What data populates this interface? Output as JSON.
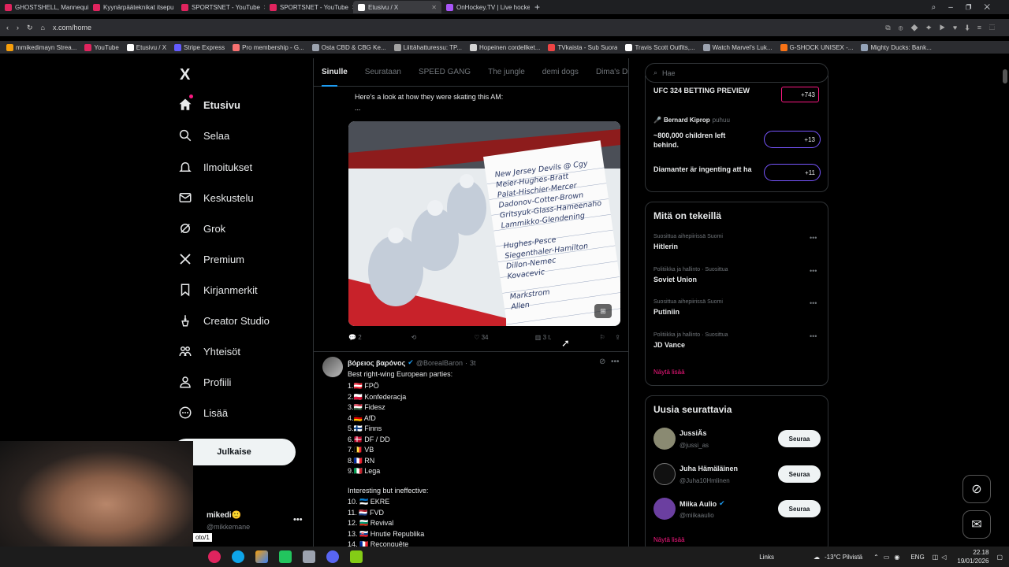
{
  "browser": {
    "tabs": [
      {
        "title": "GHOSTSHELL, Mannequin",
        "color": "#e0245e"
      },
      {
        "title": "Kyynärpääteknikat itsepu",
        "color": "#e0245e"
      },
      {
        "title": "SPORTSNET - YouTube",
        "color": "#e0245e"
      },
      {
        "title": "SPORTSNET - YouTube",
        "color": "#e0245e"
      },
      {
        "title": "Etusivu / X",
        "color": "#ffffff"
      },
      {
        "title": "OnHockey.TV | Live hocke",
        "color": "#a855f7"
      }
    ],
    "url": "x.com/home",
    "bookmarks": [
      "mmikedimayn Strea...",
      "YouTube",
      "Etusivu / X",
      "Stripe Express",
      "Pro membership - G...",
      "Osta CBD & CBG Ke...",
      "Liittähatturessu: TP...",
      "Hopeinen cordellket...",
      "TVkaista - Sub Suora",
      "Travis Scott Outfits,...",
      "Watch Marvel's Luk...",
      "G-SHOCK UNISEX -...",
      "Mighty Ducks: Bank..."
    ]
  },
  "nav": {
    "logo": "X",
    "items": [
      {
        "label": "Etusivu",
        "icon": "home-icon"
      },
      {
        "label": "Selaa",
        "icon": "search-icon"
      },
      {
        "label": "Ilmoitukset",
        "icon": "bell-icon"
      },
      {
        "label": "Keskustelu",
        "icon": "mail-icon"
      },
      {
        "label": "Grok",
        "icon": "grok-icon"
      },
      {
        "label": "Premium",
        "icon": "x-icon"
      },
      {
        "label": "Kirjanmerkit",
        "icon": "bookmark-icon"
      },
      {
        "label": "Creator Studio",
        "icon": "creator-icon"
      },
      {
        "label": "Yhteisöt",
        "icon": "communities-icon"
      },
      {
        "label": "Profiili",
        "icon": "person-icon"
      },
      {
        "label": "Lisää",
        "icon": "more-icon"
      }
    ],
    "post_button": "Julkaise",
    "account": {
      "name": "mikedi🙂",
      "handle": "@mikkemane"
    },
    "tooltip": "oto/1"
  },
  "feed": {
    "tabs": [
      "Sinulle",
      "Seurataan",
      "SPEED GANG",
      "The jungle",
      "demi dogs",
      "Dima's Dist"
    ],
    "post1": {
      "text": "Here's a look at how they were skating this AM:",
      "ellipsis": "...",
      "notepad_lines": [
        "New Jersey Devils @ Cgy",
        "Meier-Hughes-Bratt",
        "Palat-Hischier-Mercer",
        "Dadonov-Cotter-Brown",
        "Gritsyuk-Glass-Hameenaho",
        "Lammikko-Glendening",
        "",
        "Hughes-Pesce",
        "Siegenthaler-Hamilton",
        "Dillon-Nemec",
        "Kovacevic",
        "",
        "Markstrom",
        "Allen"
      ],
      "stats": {
        "replies": "2",
        "reposts": "",
        "likes": "34",
        "views": "3 t."
      }
    },
    "post2": {
      "author": "βόρειος βαρόνος",
      "handle": "@BorealBaron",
      "time": "3t",
      "header": "Best right-wing European parties:",
      "list": [
        "1.🇦🇹 FPÖ",
        "2.🇵🇱 Konfederacja",
        "3.🇭🇺 Fidesz",
        "4.🇩🇪 AfD",
        "5.🇫🇮 Finns",
        "6.🇩🇰 DF / DD",
        "7.🇧🇪 VB",
        "8.🇫🇷 RN",
        "9.🇮🇹 Lega"
      ],
      "subheader": "Interesting but ineffective:",
      "list2": [
        "10. 🇪🇪 EKRE",
        "11. 🇳🇱 FVD",
        "12. 🇧🇬 Revival",
        "13. 🇸🇰 Hnutie Republika",
        "14. 🇫🇷 Reconquête"
      ]
    }
  },
  "right": {
    "search_placeholder": "Hae",
    "spaces": [
      {
        "title": "UFC 324 BETTING PREVIEW",
        "badge": "+743"
      },
      {
        "host": "Bernard Kiprop",
        "host_meta": "puhuu",
        "title": "~800,000 children left behind.",
        "badge": "+13"
      },
      {
        "title": "Diamanter är ingenting att ha",
        "badge": "+11"
      }
    ],
    "trends_title": "Mitä on tekeillä",
    "trends": [
      {
        "meta": "Suosittua aihepiirissä Suomi",
        "name": "Hitlerin"
      },
      {
        "meta": "Politiikka ja hallinto · Suosittua",
        "name": "Soviet Union"
      },
      {
        "meta": "Suosittua aihepiirissä Suomi",
        "name": "Putiniin"
      },
      {
        "meta": "Politiikka ja hallinto · Suosittua",
        "name": "JD Vance"
      }
    ],
    "trends_more": "Näytä lisää",
    "follow_title": "Uusia seurattavia",
    "follows": [
      {
        "name": "JussiÄs",
        "handle": "@jussi_as"
      },
      {
        "name": "Juha Hämäläinen",
        "handle": "@Juha10Hmlinen"
      },
      {
        "name": "Miika Aulio",
        "handle": "@miikaaulio"
      }
    ],
    "follow_button": "Seuraa",
    "follow_more": "Näytä lisää"
  },
  "taskbar": {
    "links": "Links",
    "weather": "-13°C Pilvistä",
    "lang": "ENG",
    "time": "22.18",
    "date": "19/01/2026"
  }
}
